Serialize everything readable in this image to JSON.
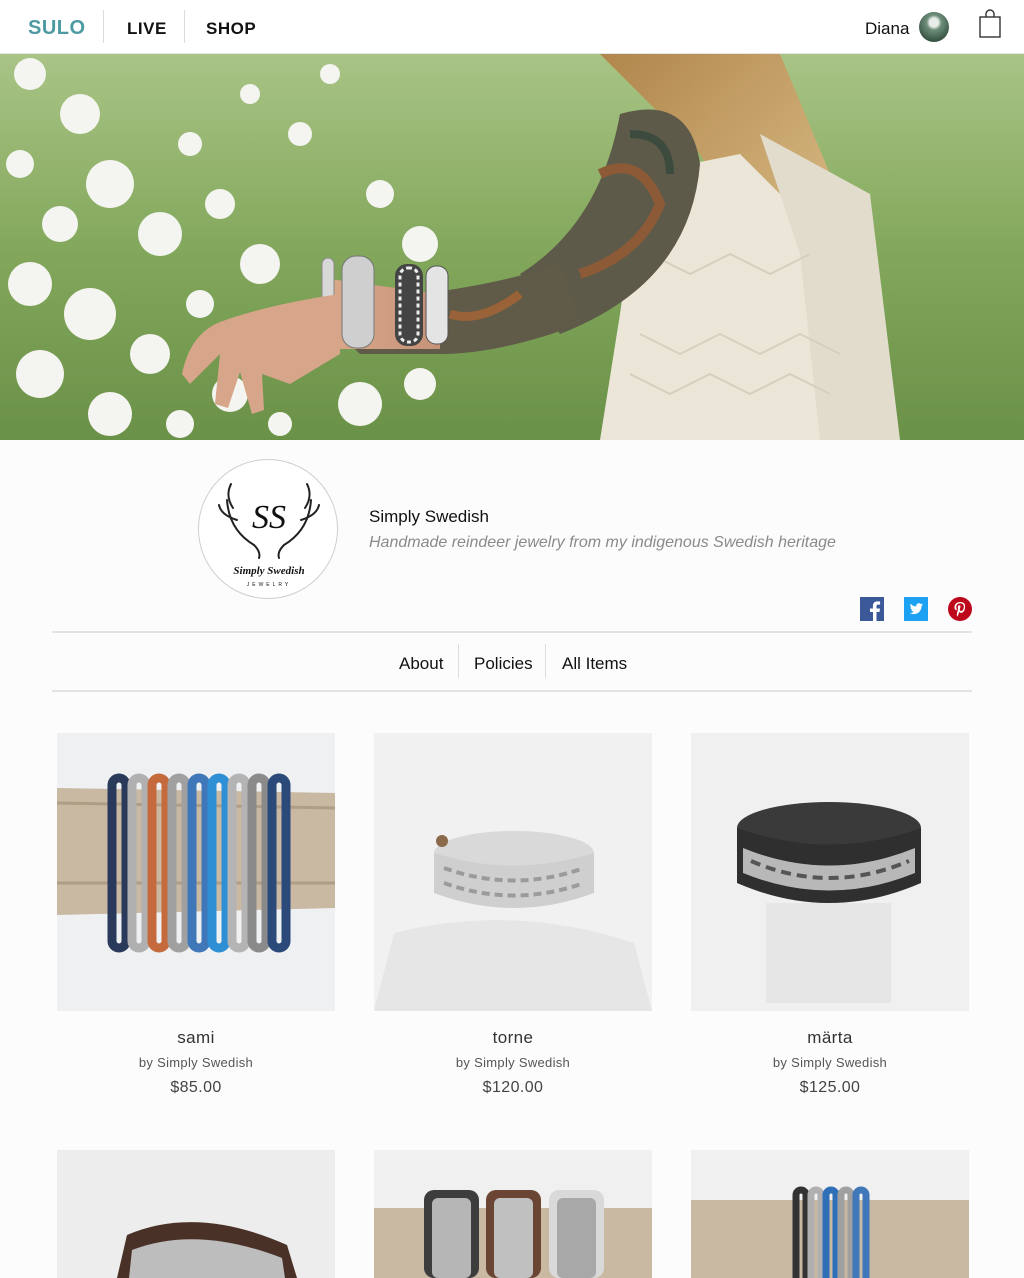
{
  "nav": {
    "brand": "SULO",
    "links": [
      {
        "label": "LIVE"
      },
      {
        "label": "SHOP"
      }
    ],
    "user_name": "Diana",
    "icons": {
      "cart": "shopping-bag-icon",
      "avatar": "user-avatar"
    }
  },
  "shop": {
    "logo_text": "Simply Swedish",
    "logo_sub": "JEWELRY",
    "logo_monogram": "SS",
    "name": "Simply Swedish",
    "tagline": "Handmade reindeer jewelry from my indigenous Swedish heritage",
    "social": [
      {
        "icon": "facebook-icon",
        "color": "#3b5998"
      },
      {
        "icon": "twitter-icon",
        "color": "#1da1f2"
      },
      {
        "icon": "pinterest-icon",
        "color": "#bd081c"
      }
    ]
  },
  "tabs": [
    {
      "label": "About"
    },
    {
      "label": "Policies"
    },
    {
      "label": "All Items"
    }
  ],
  "products": [
    {
      "name": "sami",
      "by": "by Simply Swedish",
      "price": "$85.00"
    },
    {
      "name": "torne",
      "by": "by Simply Swedish",
      "price": "$120.00"
    },
    {
      "name": "märta",
      "by": "by Simply Swedish",
      "price": "$125.00"
    },
    {
      "name": "",
      "by": "",
      "price": ""
    },
    {
      "name": "",
      "by": "",
      "price": ""
    },
    {
      "name": "",
      "by": "",
      "price": ""
    }
  ],
  "colors": {
    "brand": "#4e9aa3"
  }
}
